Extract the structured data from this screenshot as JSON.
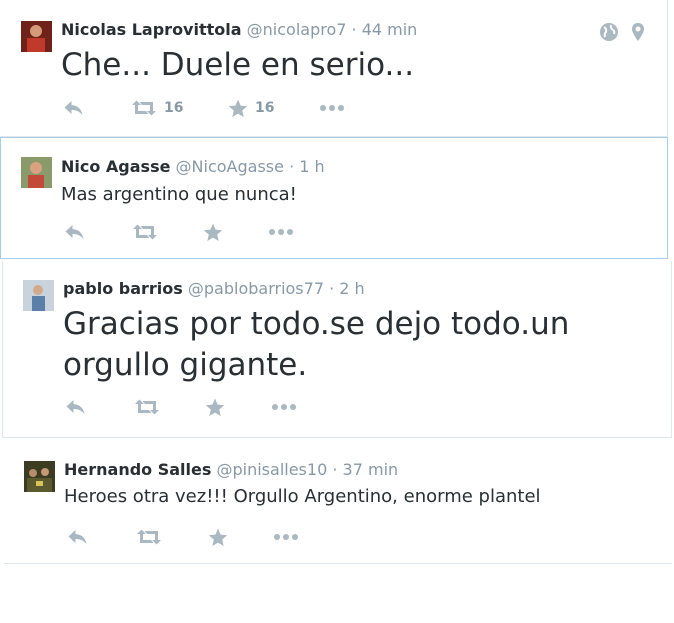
{
  "tweets": [
    {
      "name": "Nicolas Laprovittola",
      "handle": "@nicolapro7",
      "time": "44 min",
      "text": "Che... Duele en serio...",
      "retweets": "16",
      "favorites": "16",
      "avatar_color": "#b23a2a"
    },
    {
      "name": "Nico Agasse",
      "handle": "@NicoAgasse",
      "time": "1 h",
      "text": "Mas argentino que nunca!",
      "avatar_color": "#c24a3a"
    },
    {
      "name": "pablo barrios",
      "handle": "@pablobarrios77",
      "time": "2 h",
      "text_lines": [
        "Gracias por todo.se dejo todo.un",
        "orgullo gigante."
      ],
      "avatar_color": "#5a7fa8"
    },
    {
      "name": "Hernando Salles",
      "handle": "@pinisalles10",
      "time": "37 min",
      "text": "Heroes otra vez!!! Orgullo Argentino, enorme plantel",
      "avatar_color": "#5a5a2e"
    }
  ],
  "separator": "·",
  "icons": {
    "reply": "reply-icon",
    "retweet": "retweet-icon",
    "favorite": "star-icon",
    "more": "more-icon",
    "globe": "globe-icon",
    "location": "location-pin-icon"
  },
  "colors": {
    "action_icon": "#aab8c2",
    "meta_text": "#8899a6",
    "highlight_border": "#a9cfe6"
  }
}
